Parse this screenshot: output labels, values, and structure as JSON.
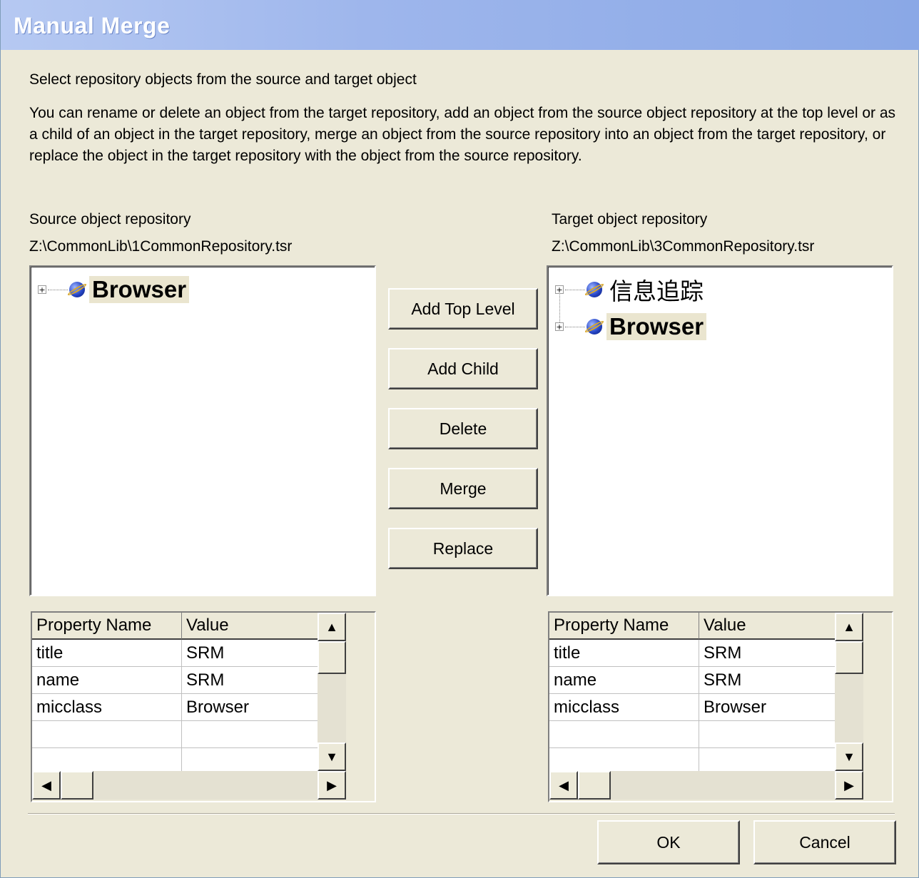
{
  "window": {
    "title": "Manual Merge"
  },
  "instructions": {
    "line1": "Select repository objects from the source and target object",
    "paragraph": "You can rename or delete an object from the target repository, add an object from the source object repository at the top level or as a child of an object in the target repository, merge an object from the source repository into an object from the target repository, or replace the object in the target repository with the object from the source repository."
  },
  "source": {
    "label": "Source object repository",
    "path": "Z:\\CommonLib\\1CommonRepository.tsr",
    "tree": [
      {
        "label": "Browser",
        "icon": "globe-icon",
        "expander": "+"
      }
    ],
    "grid": {
      "headers": [
        "Property Name",
        "Value"
      ],
      "rows": [
        [
          "title",
          "SRM"
        ],
        [
          "name",
          "SRM"
        ],
        [
          "micclass",
          "Browser"
        ],
        [
          "",
          ""
        ],
        [
          "",
          ""
        ]
      ]
    }
  },
  "target": {
    "label": "Target object repository",
    "path": "Z:\\CommonLib\\3CommonRepository.tsr",
    "tree": [
      {
        "label": "信息追踪",
        "icon": "globe-icon",
        "expander": "+"
      },
      {
        "label": "Browser",
        "icon": "globe-icon",
        "expander": "+"
      }
    ],
    "grid": {
      "headers": [
        "Property Name",
        "Value"
      ],
      "rows": [
        [
          "title",
          "SRM"
        ],
        [
          "name",
          "SRM"
        ],
        [
          "micclass",
          "Browser"
        ],
        [
          "",
          ""
        ],
        [
          "",
          ""
        ]
      ]
    }
  },
  "actions": {
    "add_top_level": "Add Top Level",
    "add_child": "Add Child",
    "delete": "Delete",
    "merge": "Merge",
    "replace": "Replace"
  },
  "footer": {
    "ok": "OK",
    "cancel": "Cancel"
  },
  "scroll": {
    "up": "▲",
    "down": "▼",
    "left": "◀",
    "right": "▶"
  }
}
